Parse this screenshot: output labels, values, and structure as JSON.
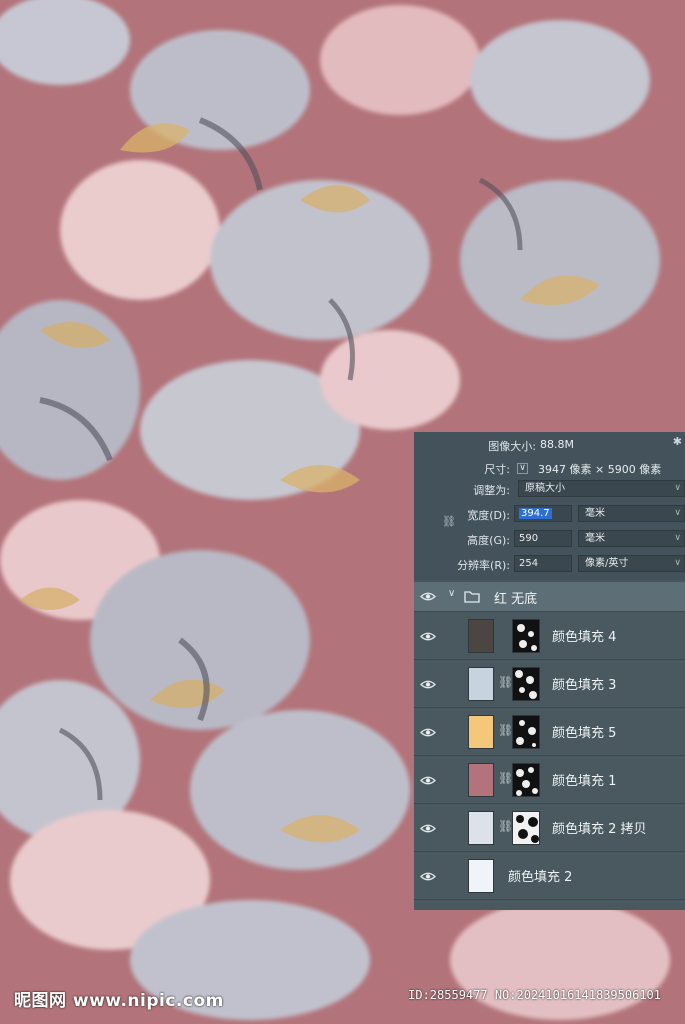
{
  "colors": {
    "background": "#b2747a",
    "panel": "#495860",
    "selection": "#2f6fd1"
  },
  "image_size": {
    "size_label": "图像大小:",
    "size_value": "88.8M",
    "dimensions_label": "尺寸:",
    "dimensions_value": "3947 像素 × 5900 像素",
    "fit_label": "调整为:",
    "fit_value": "原稿大小",
    "width_label": "宽度(D):",
    "width_value": "394.7",
    "width_unit": "毫米",
    "height_label": "高度(G):",
    "height_value": "590",
    "height_unit": "毫米",
    "resolution_label": "分辨率(R):",
    "resolution_value": "254",
    "resolution_unit": "像素/英寸"
  },
  "layers": {
    "group_name": "红 无底",
    "items": [
      {
        "name": "颜色填充 4",
        "color": "#4c4541",
        "linked": false
      },
      {
        "name": "颜色填充 3",
        "color": "#c7d3de",
        "linked": true
      },
      {
        "name": "颜色填充 5",
        "color": "#f5c77a",
        "linked": true
      },
      {
        "name": "颜色填充 1",
        "color": "#b2747a",
        "linked": true
      },
      {
        "name": "颜色填充 2 拷贝",
        "color": "#dde2ea",
        "linked": true
      },
      {
        "name": "颜色填充 2",
        "color": "#f0f3f7",
        "linked": false
      }
    ]
  },
  "watermark": {
    "logo": "昵图网 www.nipic.com",
    "id": "ID:28559477 NO:20241016141839506101"
  }
}
